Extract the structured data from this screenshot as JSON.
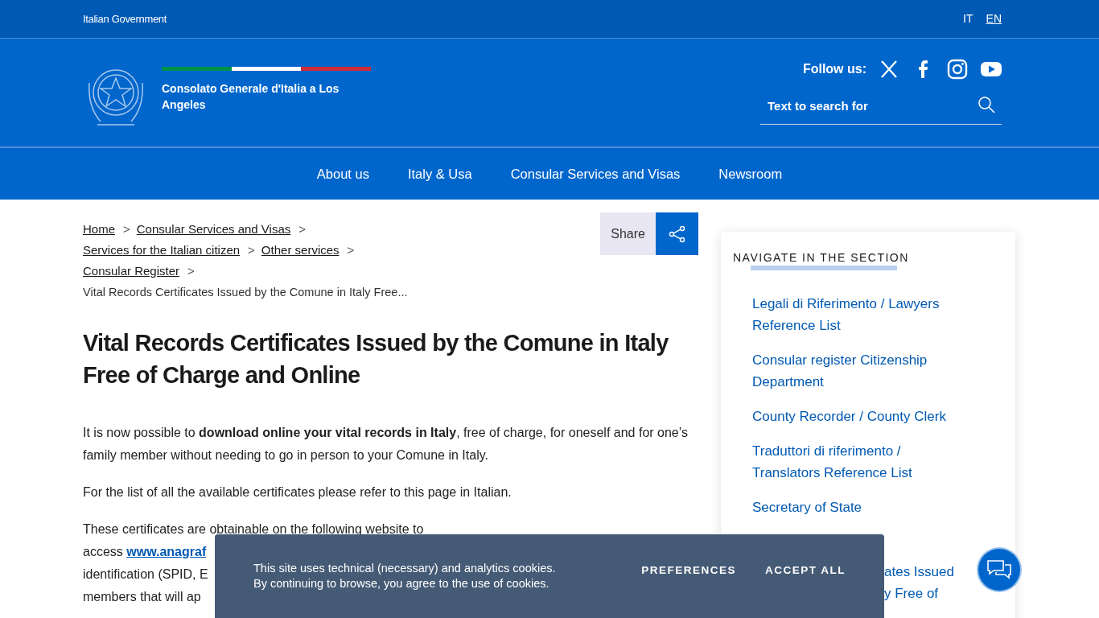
{
  "top_bar": {
    "label": "Italian Government",
    "languages": [
      {
        "code": "IT",
        "selected": false
      },
      {
        "code": "EN",
        "selected": true
      }
    ]
  },
  "header": {
    "title": "Consolato Generale d'Italia a Los Angeles",
    "follow_label": "Follow us:",
    "socials": [
      {
        "kind": "x"
      },
      {
        "kind": "facebook"
      },
      {
        "kind": "instagram"
      },
      {
        "kind": "youtube"
      }
    ],
    "search": {
      "placeholder": "Text to search for"
    }
  },
  "nav": [
    "About us",
    "Italy & Usa",
    "Consular Services and Visas",
    "Newsroom"
  ],
  "breadcrumbs": {
    "separator": ">",
    "links": [
      "Home",
      "Consular Services and Visas",
      "Services for the Italian citizen",
      "Other services",
      "Consular Register"
    ],
    "current": "Vital Records Certificates Issued by the Comune in Italy Free..."
  },
  "share": {
    "label": "Share"
  },
  "title": "Vital Records Certificates Issued by the Comune in Italy Free of Charge and Online",
  "paragraphs": [
    "It is now possible to **download online your vital records in Italy**, free of charge, for oneself and for one’s family member without needing to go in person to your Comune in Italy.",
    "For the list of all the available certificates please refer to this page in Italian."
  ],
  "covered_paragraph": [
    {
      "text": "These certificates are obtainable on the following website to"
    },
    {
      "text": "access ",
      "link": "www.anagraf"
    },
    {
      "text": "identification (SPID, E"
    },
    {
      "text": "members that will ap"
    }
  ],
  "sidebar": {
    "heading": "NAVIGATE IN THE SECTION",
    "items": [
      "Legali di Riferimento / Lawyers Reference List",
      "Consular register Citizenship Department",
      "County Recorder / County Clerk",
      "Traduttori di riferimento / Translators Reference List",
      "Secretary of State"
    ],
    "covered_item": [
      "ates Issued",
      "y Free of"
    ]
  },
  "cookie_banner": {
    "lines": [
      "This site uses technical (necessary) and analytics cookies.",
      "By continuing to browse, you agree to the use of cookies."
    ],
    "buttons": [
      "PREFERENCES",
      "ACCEPT ALL"
    ]
  }
}
